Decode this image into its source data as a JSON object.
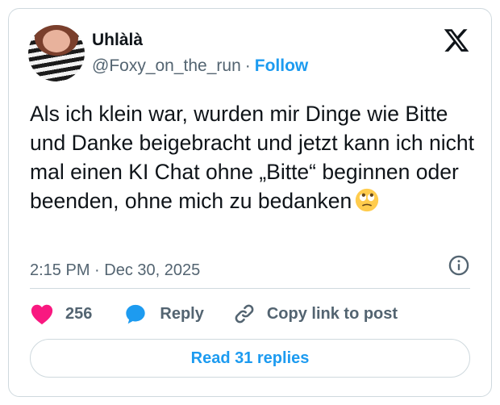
{
  "author": {
    "display_name": "Uhlàlà",
    "handle": "@Foxy_on_the_run",
    "separator": "·",
    "follow_label": "Follow"
  },
  "tweet": {
    "text": "Als ich klein war, wurden mir Dinge wie Bitte und Danke beigebracht und jetzt kann ich nicht mal einen KI Chat ohne „Bitte“ beginnen oder beenden, ohne mich zu bedanken",
    "emoji": "face-with-rolling-eyes",
    "timestamp": "2:15 PM · Dec 30, 2025"
  },
  "actions": {
    "like_count": "256",
    "reply_label": "Reply",
    "copy_link_label": "Copy link to post"
  },
  "read_replies_label": "Read 31 replies",
  "colors": {
    "accent": "#1d9bf0",
    "like": "#f91880",
    "text": "#0f1419",
    "muted": "#536471",
    "border": "#cfd9de"
  },
  "icons": [
    "x-logo-icon",
    "info-icon",
    "heart-icon",
    "reply-bubble-icon",
    "link-icon",
    "rolling-eyes-emoji-icon"
  ]
}
